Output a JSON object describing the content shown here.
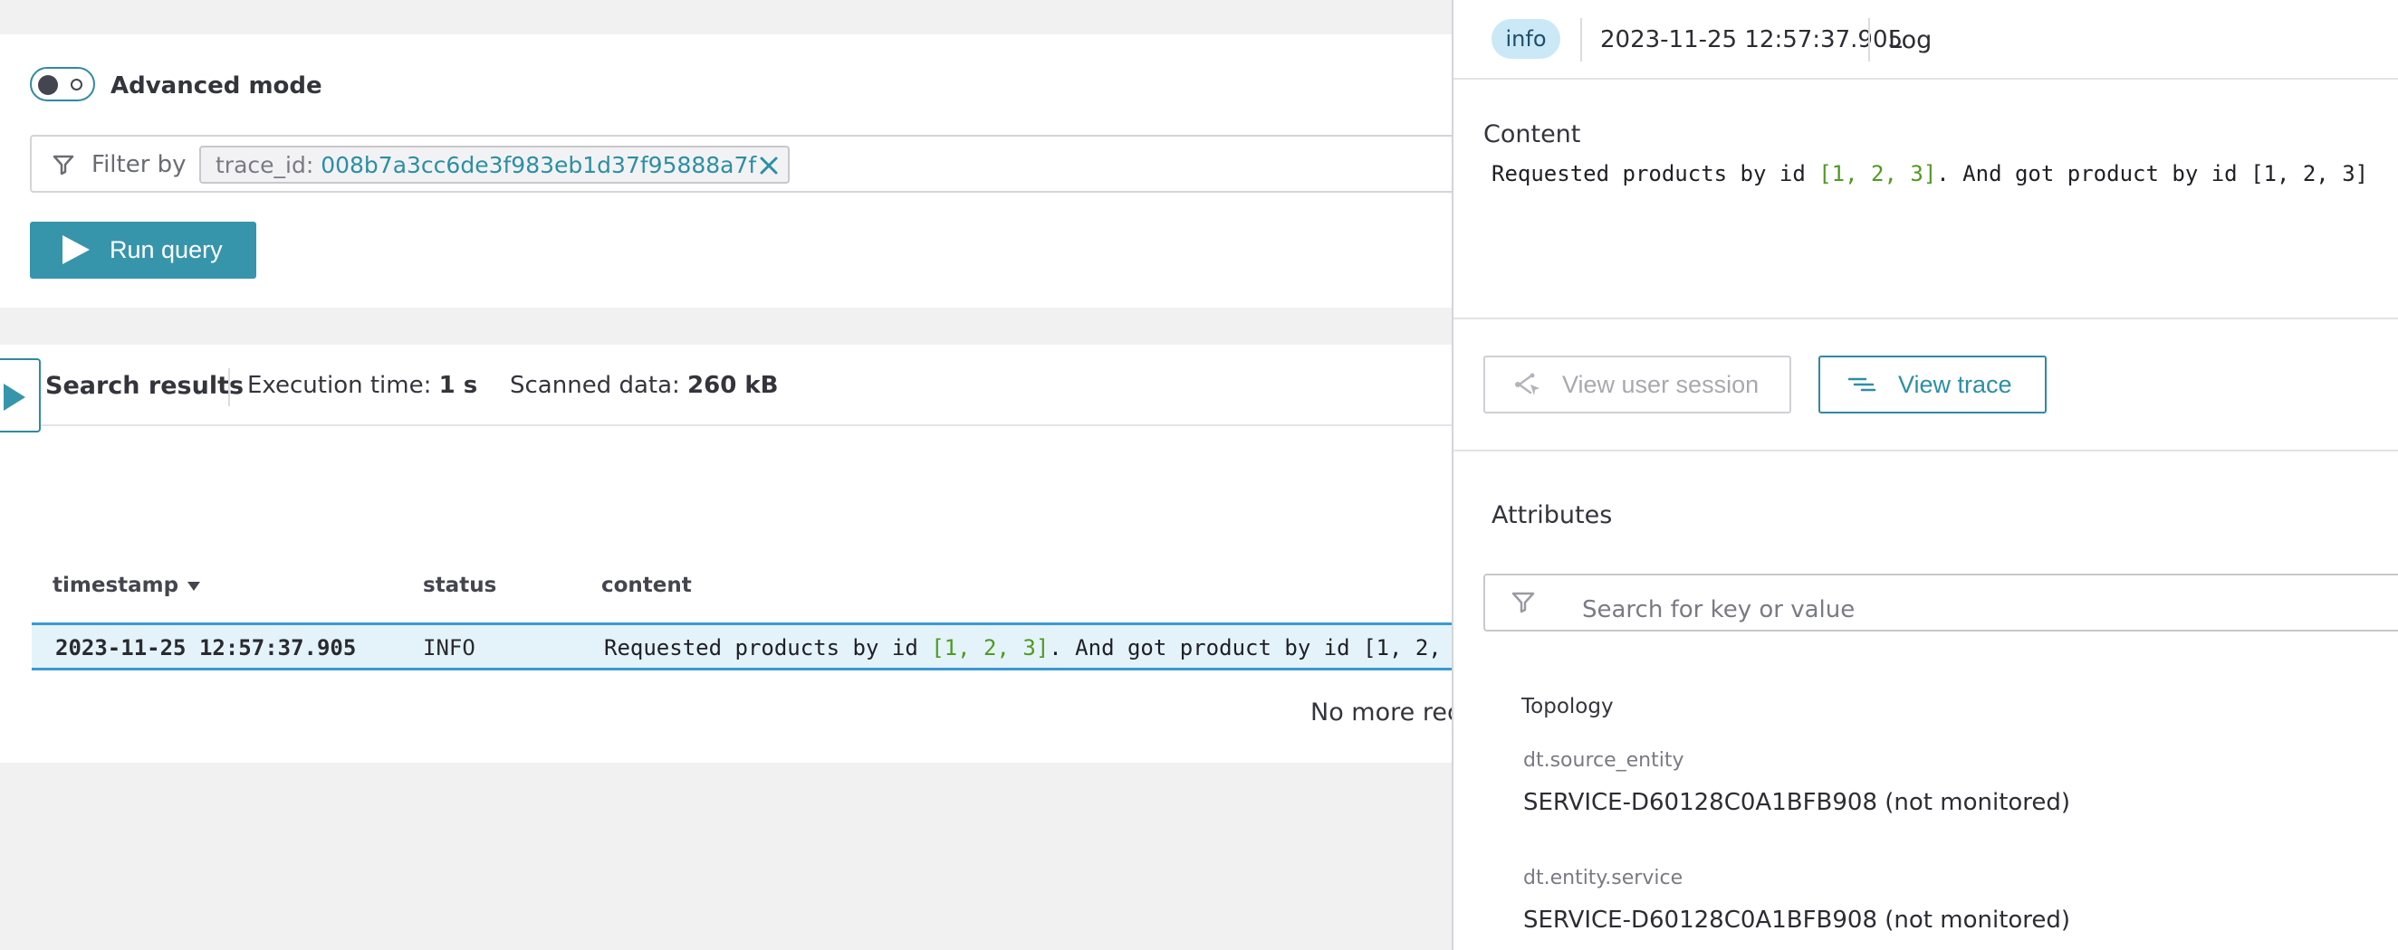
{
  "query": {
    "advanced_mode_label": "Advanced mode",
    "filter_by_label": "Filter by",
    "filter_chip_key": "trace_id:",
    "filter_chip_value": "008b7a3cc6de3f983eb1d37f95888a7f",
    "run_query_label": "Run query"
  },
  "results": {
    "title": "Search results",
    "execution_label": "Execution time:",
    "execution_value": "1 s",
    "scanned_label": "Scanned data:",
    "scanned_value": "260 kB",
    "columns": [
      "timestamp",
      "status",
      "content"
    ],
    "rows": [
      {
        "timestamp": "2023-11-25 12:57:37.905",
        "status": "INFO",
        "content_pre": "Requested products by id ",
        "content_highlight": "[1, 2, 3]",
        "content_post": ". And got product by id [1, 2,"
      }
    ],
    "no_more_label": "No more reco"
  },
  "detail": {
    "level_badge": "info",
    "timestamp": "2023-11-25 12:57:37.905",
    "type": "Log",
    "content_label": "Content",
    "content_pre": "Requested products by id ",
    "content_highlight": "[1, 2, 3]",
    "content_post": ". And got product by id [1, 2, 3]",
    "view_user_session_label": "View user session",
    "view_trace_label": "View trace",
    "attributes_label": "Attributes",
    "search_placeholder": "Search for key or value",
    "topology_label": "Topology",
    "attributes": [
      {
        "key": "dt.source_entity",
        "value": "SERVICE-D60128C0A1BFB908 (not monitored)"
      },
      {
        "key": "dt.entity.service",
        "value": "SERVICE-D60128C0A1BFB908 (not monitored)"
      }
    ]
  },
  "colors": {
    "accent": "#3795ab",
    "highlight_row": "#e4f3fa",
    "row_border": "#3a9ad3",
    "badge_bg": "#cbe8f6",
    "code_green": "#4f9a1f"
  }
}
